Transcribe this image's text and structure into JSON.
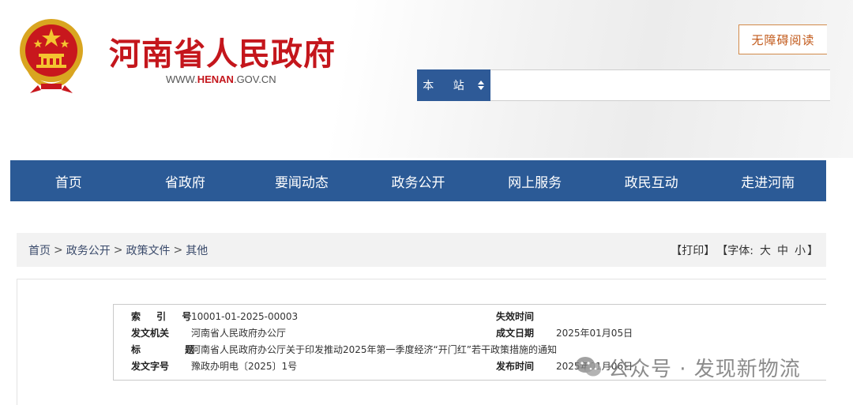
{
  "header": {
    "site_title": "河南省人民政府",
    "url_prefix": "WWW.",
    "url_highlight": "HENAN",
    "url_suffix": ".GOV.CN",
    "accessibility_button": "无障碍阅读",
    "search_scope": "本 站",
    "search_placeholder": ""
  },
  "nav": {
    "items": [
      "首页",
      "省政府",
      "要闻动态",
      "政务公开",
      "网上服务",
      "政民互动",
      "走进河南"
    ]
  },
  "breadcrumb": {
    "items": [
      "首页",
      "政务公开",
      "政策文件",
      "其他"
    ],
    "separator": ">"
  },
  "tools": {
    "print": "【打印】",
    "font_label": "【字体:",
    "large": "大",
    "medium": "中",
    "small": "小",
    "close": "】"
  },
  "meta": {
    "index_label": "索 引 号",
    "index_value": "10001-01-2025-00003",
    "expiry_label": "失效时间",
    "expiry_value": "",
    "issuer_label": "发文机关",
    "issuer_value": "河南省人民政府办公厅",
    "created_label": "成文日期",
    "created_value": "2025年01月05日",
    "title_label": "标 题",
    "title_value": "河南省人民政府办公厅关于印发推动2025年第一季度经济“开门红”若干政策措施的通知",
    "doc_no_label": "发文字号",
    "doc_no_value": "豫政办明电〔2025〕1号",
    "publish_label": "发布时间",
    "publish_value": "2025年01月06日"
  },
  "watermark": {
    "text": "公众号 · 发现新物流"
  },
  "colors": {
    "brand_red": "#c4161c",
    "nav_blue": "#2b5a96",
    "accent_orange": "#c25a1b"
  }
}
